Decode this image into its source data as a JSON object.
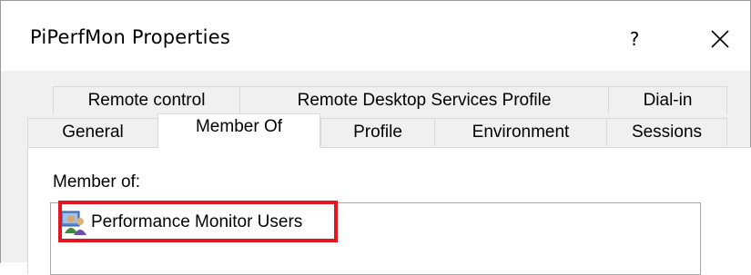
{
  "window": {
    "title": "PiPerfMon Properties",
    "help_label": "?",
    "close_label": "close"
  },
  "tabs": {
    "row1": [
      {
        "label": "Remote control"
      },
      {
        "label": "Remote Desktop Services Profile"
      },
      {
        "label": "Dial-in"
      }
    ],
    "row2": [
      {
        "label": "General"
      },
      {
        "label": "Member Of",
        "active": true
      },
      {
        "label": "Profile"
      },
      {
        "label": "Environment"
      },
      {
        "label": "Sessions"
      }
    ]
  },
  "member_of": {
    "label": "Member of:",
    "items": [
      {
        "name": "Performance Monitor Users",
        "icon": "group-icon"
      }
    ]
  },
  "colors": {
    "highlight": "#e4151f",
    "dialog_bg": "#f0f0f0"
  }
}
